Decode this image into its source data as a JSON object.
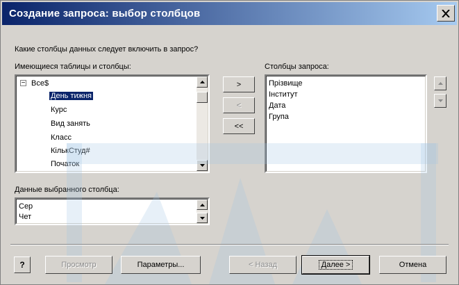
{
  "window": {
    "title": "Создание запроса: выбор столбцов"
  },
  "prompt": "Какие столбцы данных следует включить в запрос?",
  "available": {
    "label": "Имеющиеся таблицы и столбцы:",
    "root": "Все$",
    "root_expander": "−",
    "items": [
      "День тижня",
      "Курс",
      "Вид занять",
      "Класс",
      "КількСтуд#",
      "Початок"
    ],
    "selected_index": 0
  },
  "query": {
    "label": "Столбцы запроса:",
    "items": [
      "Прізвище",
      "Інститут",
      "Дата",
      "Група"
    ]
  },
  "move": {
    "add": ">",
    "remove": "<",
    "remove_all": "<<"
  },
  "preview": {
    "label": "Данные выбранного столбца:",
    "values": [
      "Сер",
      "Чет"
    ]
  },
  "footer": {
    "help": "?",
    "preview": "Просмотр",
    "options": "Параметры...",
    "back": "< Назад",
    "next": "Далее >",
    "cancel": "Отмена"
  }
}
